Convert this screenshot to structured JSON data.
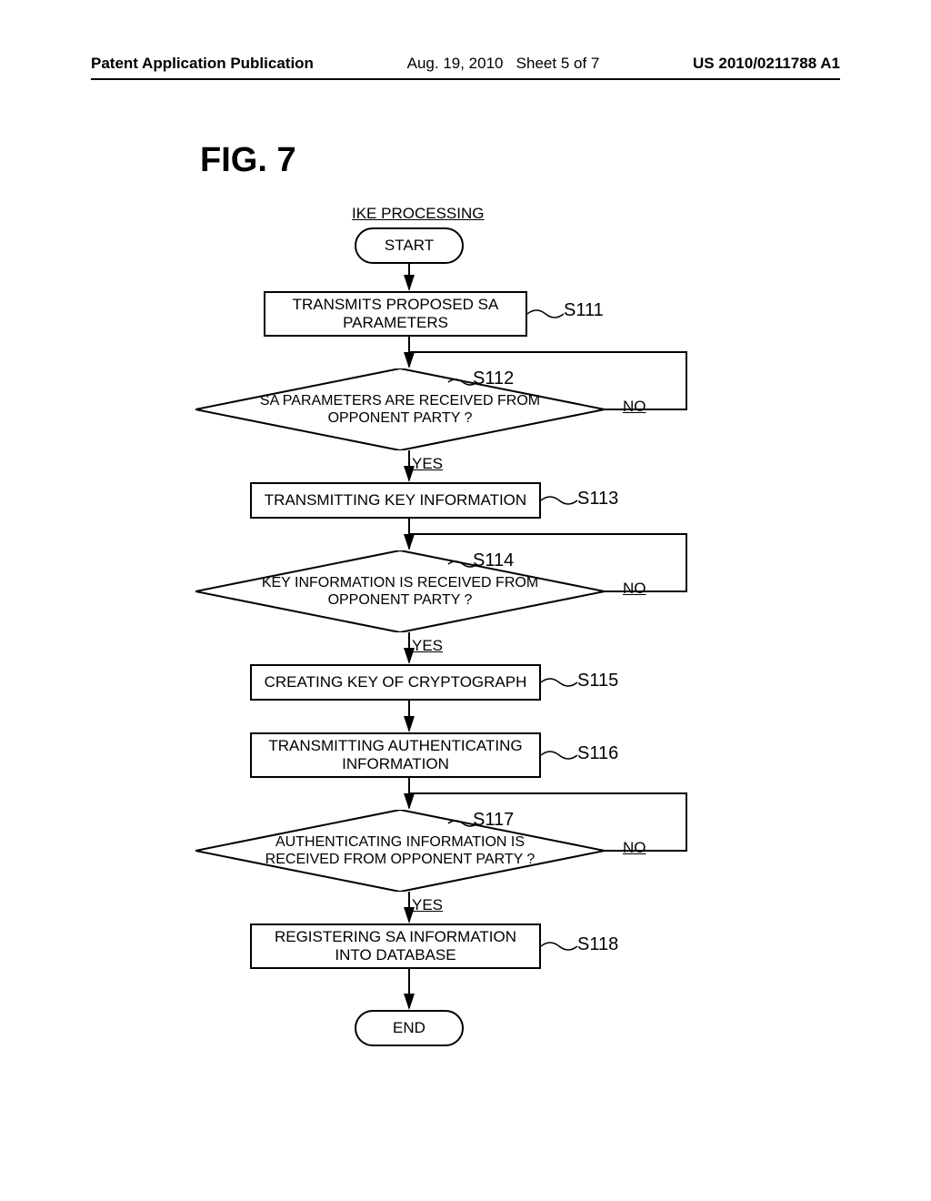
{
  "header": {
    "left": "Patent Application Publication",
    "mid_date": "Aug. 19, 2010",
    "mid_sheet": "Sheet 5 of 7",
    "right": "US 2010/0211788 A1"
  },
  "figure_label": "FIG. 7",
  "proc_title": "IKE PROCESSING",
  "terms": {
    "start": "START",
    "end": "END"
  },
  "steps": {
    "s111": "TRANSMITS PROPOSED SA PARAMETERS",
    "s112": "SA PARAMETERS ARE RECEIVED FROM OPPONENT PARTY ?",
    "s113": "TRANSMITTING KEY INFORMATION",
    "s114": "KEY INFORMATION IS RECEIVED FROM OPPONENT PARTY ?",
    "s115": "CREATING KEY OF CRYPTOGRAPH",
    "s116": "TRANSMITTING AUTHENTICATING INFORMATION",
    "s117": "AUTHENTICATING INFORMATION IS RECEIVED FROM OPPONENT PARTY ?",
    "s118": "REGISTERING SA INFORMATION INTO DATABASE"
  },
  "step_labels": {
    "s111": "S111",
    "s112": "S112",
    "s113": "S113",
    "s114": "S114",
    "s115": "S115",
    "s116": "S116",
    "s117": "S117",
    "s118": "S118"
  },
  "branches": {
    "yes": "YES",
    "no": "NO"
  }
}
